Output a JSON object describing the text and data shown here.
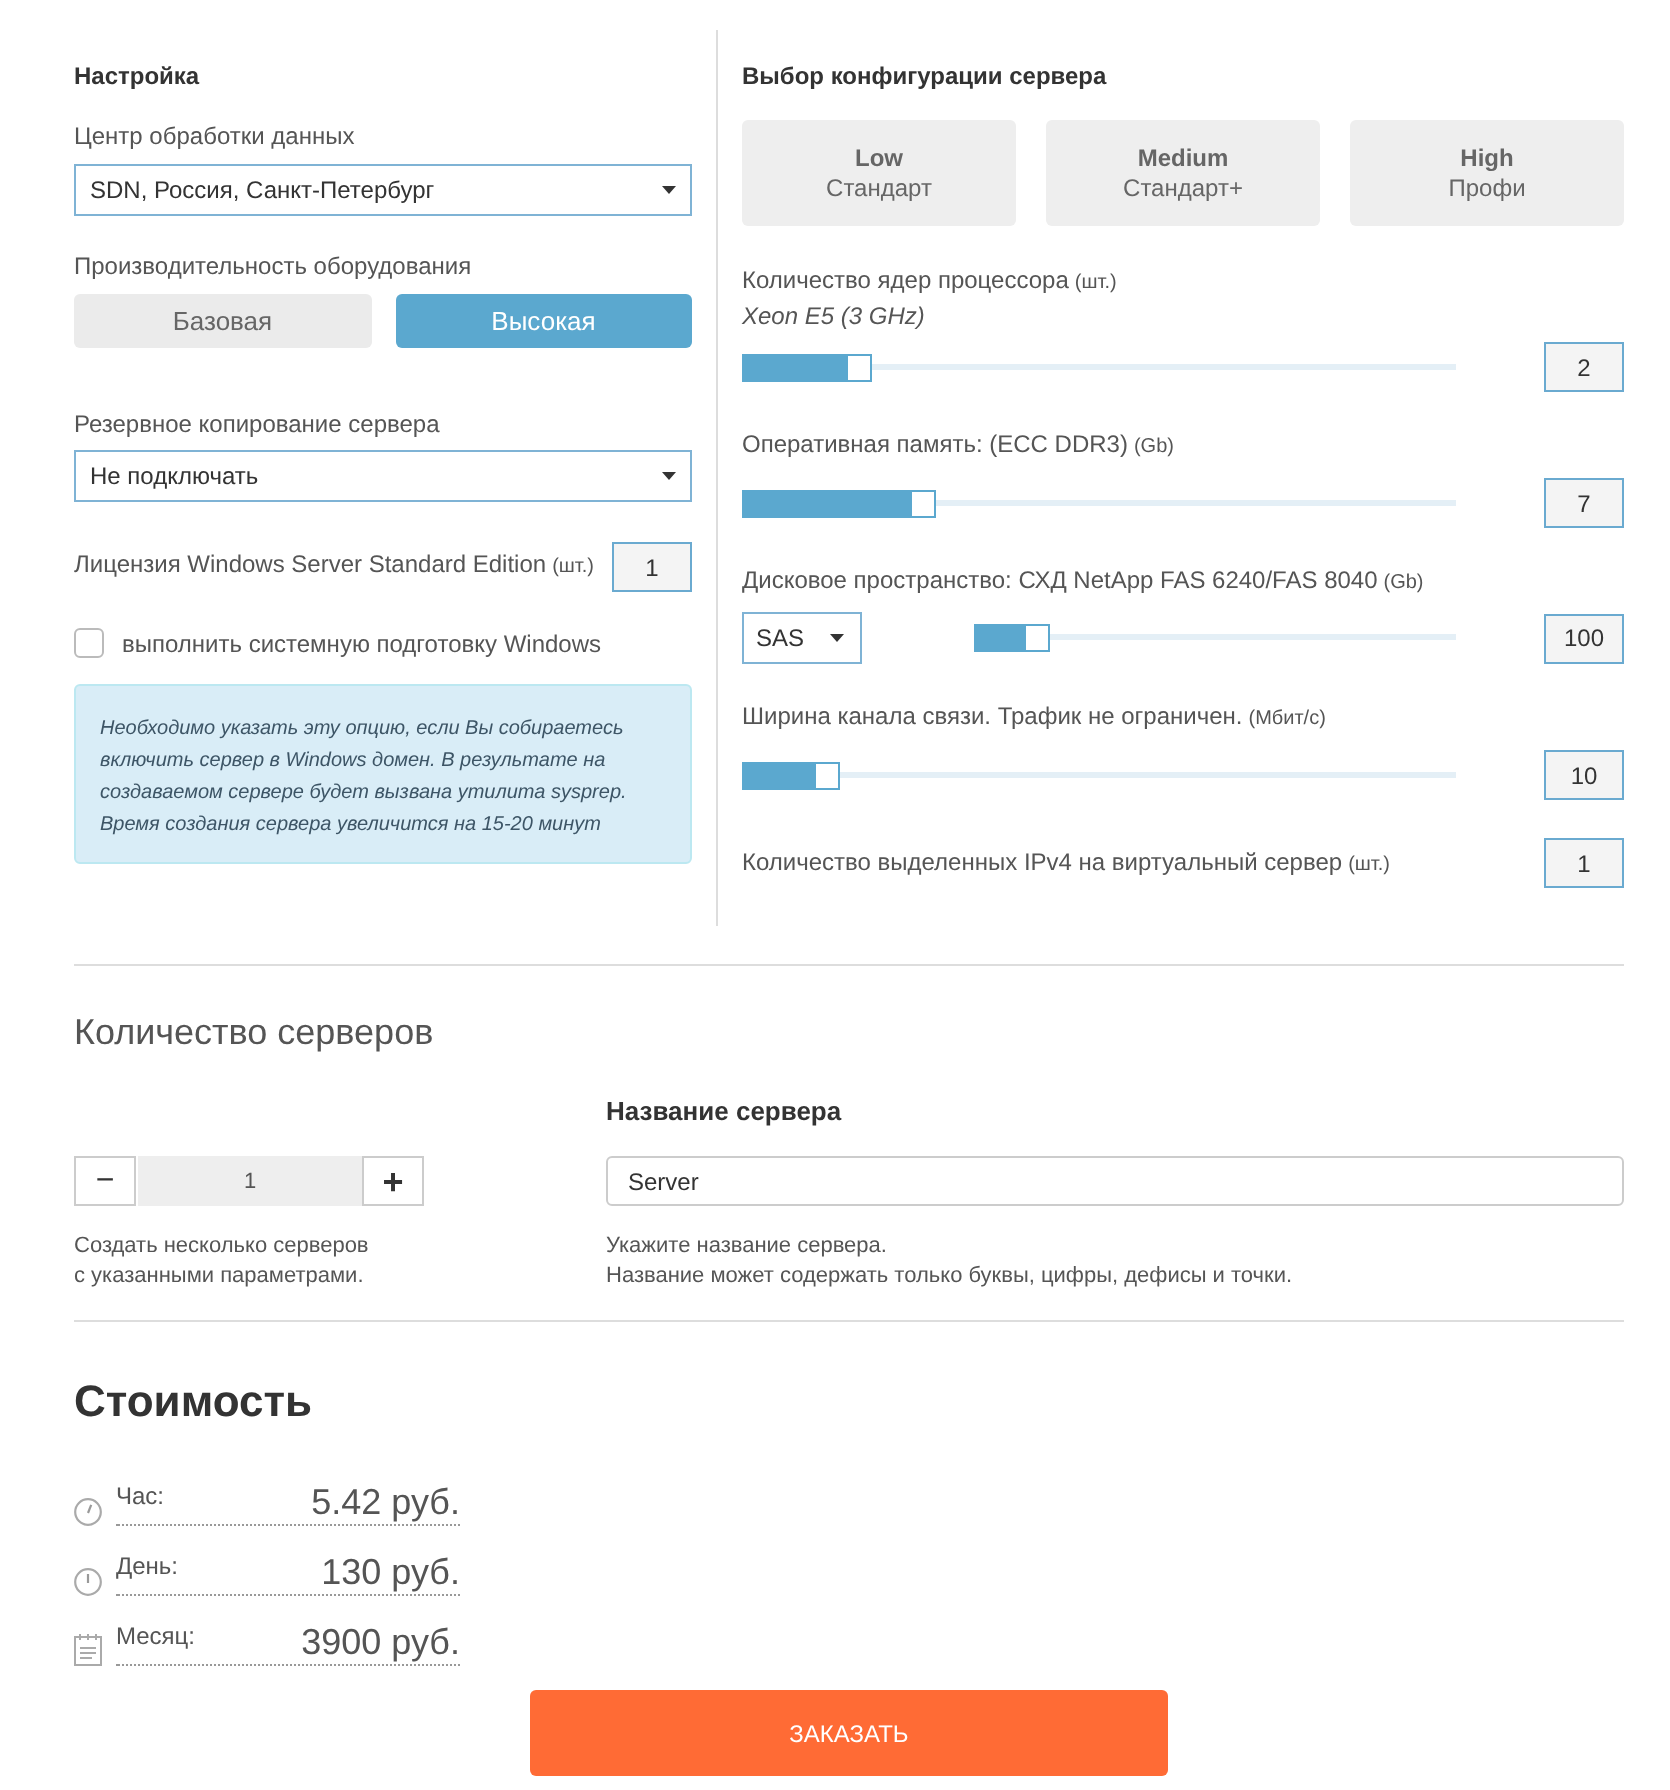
{
  "settings": {
    "title": "Настройка",
    "datacenter": {
      "label": "Центр обработки данных",
      "value": "SDN, Россия, Санкт-Петербург"
    },
    "performance": {
      "label": "Производительность оборудования",
      "options": [
        {
          "label": "Базовая",
          "selected": false
        },
        {
          "label": "Высокая",
          "selected": true
        }
      ]
    },
    "backup": {
      "label": "Резервное копирование сервера",
      "value": "Не подключать"
    },
    "license": {
      "label": "Лицензия Windows Server Standard Edition",
      "unit": "(шт.)",
      "value": "1"
    },
    "sysprep": {
      "label": "выполнить системную подготовку Windows",
      "checked": false
    },
    "note": "Необходимо указать эту опцию, если Вы собираетесь включить сервер в Windows домен. В результате на создаваемом сервере будет вызвана утилита sysprep. Время создания сервера увеличится на 15-20 минут"
  },
  "configuration": {
    "title": "Выбор конфигурации сервера",
    "presets": [
      {
        "name": "Low",
        "subtitle": "Стандарт",
        "selected": false
      },
      {
        "name": "Medium",
        "subtitle": "Стандарт+",
        "selected": false
      },
      {
        "name": "High",
        "subtitle": "Профи",
        "selected": false
      }
    ],
    "params": [
      {
        "kind": "slider",
        "label": "Количество ядер процессора",
        "unit": "(шт.)",
        "sublabel": "Xeon E5 (3 GHz)",
        "level": 0.15,
        "value": "2"
      },
      {
        "kind": "slider",
        "label": "Оперативная память: (ECC DDR3)",
        "unit": "(Gb)",
        "level": 0.245,
        "value": "7"
      },
      {
        "kind": "disk",
        "label": "Дисковое пространство: СХД NetApp FAS 6240/FAS 8040",
        "unit": "(Gb)",
        "type": "SAS",
        "level": 0.11,
        "value": "100"
      },
      {
        "kind": "slider",
        "label": "Ширина канала связи. Трафик не ограничен.",
        "unit": "(Мбит/с)",
        "level": 0.105,
        "value": "10"
      },
      {
        "kind": "number",
        "label": "Количество выделенных IPv4 на виртуальный сервер",
        "unit": "(шт.)",
        "value": "1"
      }
    ]
  },
  "servers": {
    "title": "Количество серверов",
    "decrement": "−",
    "count": "1",
    "increment": "+",
    "hint": [
      "Создать несколько серверов",
      "с указанными параметрами."
    ]
  },
  "server_name": {
    "title": "Название сервера",
    "value": "Server",
    "hint": [
      "Укажите название сервера.",
      "Название может содержать только буквы, цифры, дефисы и точки."
    ]
  },
  "cost": {
    "title": "Стоимость",
    "rows": [
      {
        "kind": "hour",
        "label": "Час:",
        "value": "5.42 руб."
      },
      {
        "kind": "day",
        "label": "День:",
        "value": "130 руб."
      },
      {
        "kind": "month",
        "label": "Месяц:",
        "value": "3900 руб."
      }
    ]
  },
  "order_button": "ЗАКАЗАТЬ"
}
